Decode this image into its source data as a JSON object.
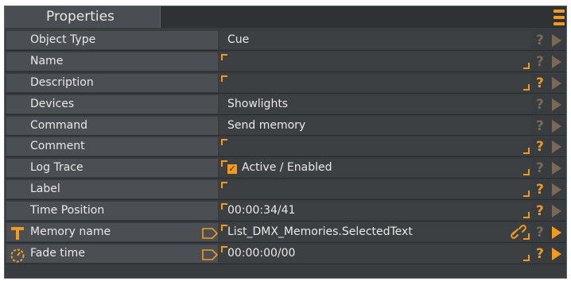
{
  "tab": {
    "title": "Properties"
  },
  "accent_color": "#f39a1e",
  "rows": [
    {
      "label": "Object Type",
      "value": "Cue"
    },
    {
      "label": "Name",
      "value": ""
    },
    {
      "label": "Description",
      "value": ""
    },
    {
      "label": "Devices",
      "value": "Showlights"
    },
    {
      "label": "Command",
      "value": "Send memory"
    },
    {
      "label": "Comment",
      "value": ""
    },
    {
      "label": "Log Trace",
      "value": "Active / Enabled",
      "checked": true
    },
    {
      "label": "Label",
      "value": ""
    },
    {
      "label": "Time Position",
      "value": "00:00:34/41"
    },
    {
      "label": "Memory name",
      "value": "List_DMX_Memories.SelectedText",
      "icon": "text-T-icon",
      "linked": true
    },
    {
      "label": "Fade time",
      "value": "00:00:00/00",
      "icon": "timer-icon"
    }
  ]
}
